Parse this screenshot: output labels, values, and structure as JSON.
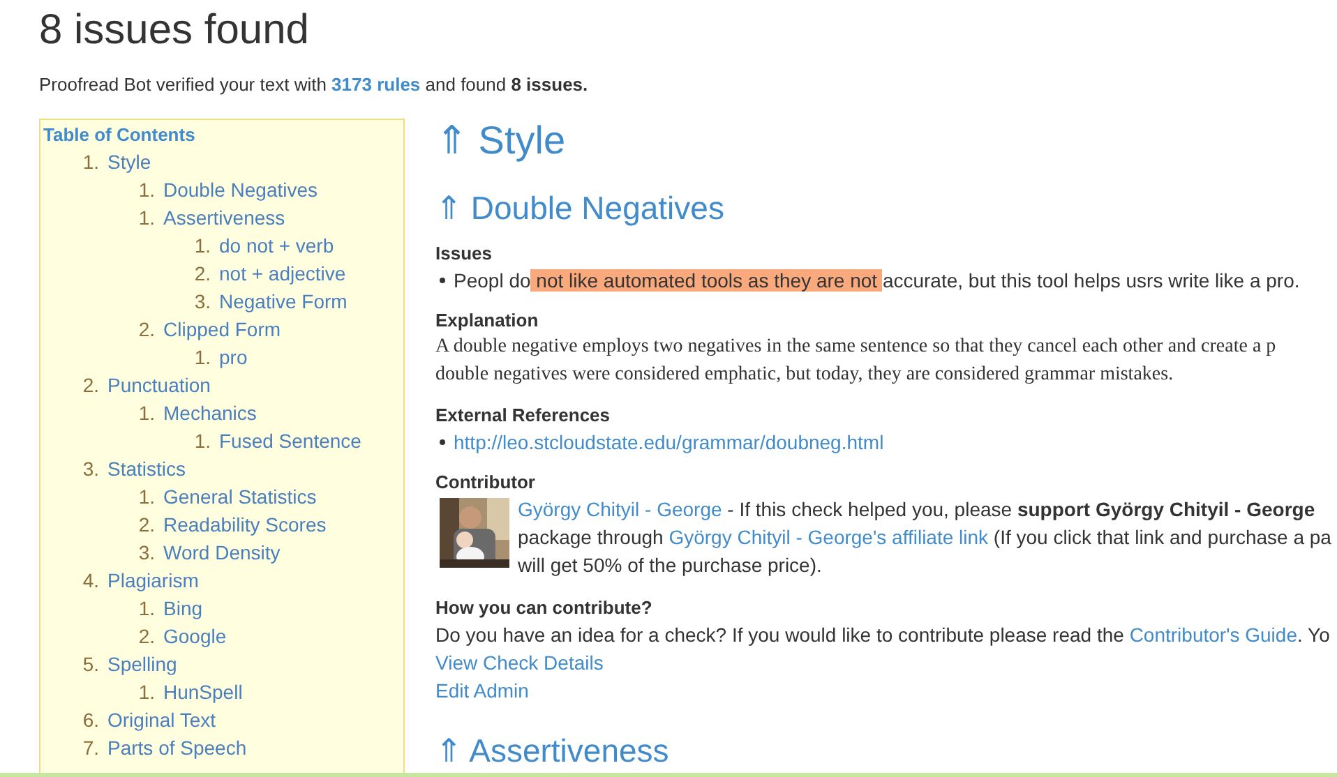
{
  "title": "8 issues found",
  "summary": "Proofread Bot verified your text with ",
  "summary_link": "3173 rules",
  "summary_end": " and found **8 issues.**",
  "toc": {
    "title": "Table of Contents",
    "items": [
      {
        "number": "1.",
        "label": "Style",
        "children": [
          {
            "number": "1.",
            "label": "Double Negatives"
          },
          {
            "number": "1.",
            "label": "Assertiveness",
            "children": [
              {
                "number": "1.",
                "label": "do not + verb"
              },
              {
                "number": "2.",
                "label": "not + adjective"
              },
              {
                "number": "3.",
                "label": "Negative Form"
              }
            ]
          },
          {
            "number": "2.",
            "label": "Clipped Form",
            "children": [
              {
                "number": "1.",
                "label": "pro"
              }
            ]
          }
        ]
      },
      {
        "number": "2.",
        "label": "Punctuation",
        "children": [
          {
            "number": "1.",
            "label": "Mechanics",
            "children": [
              {
                "number": "1.",
                "label": "Fused Sentence"
              }
            ]
          }
        ]
      },
      {
        "number": "3.",
        "label": "Statistics",
        "children": [
          {
            "number": "1.",
            "label": "General Statistics"
          },
          {
            "number": "2.",
            "label": "Readability Scores"
          },
          {
            "number": "3.",
            "label": "Word Density"
          }
        ]
      },
      {
        "number": "4.",
        "label": "Plagiarism",
        "children": [
          {
            "number": "1.",
            "label": "Bing"
          },
          {
            "number": "2.",
            "label": "Google"
          }
        ]
      },
      {
        "number": "5.",
        "label": "Spelling",
        "children": [
          {
            "number": "1.",
            "label": "HunSpell"
          }
        ]
      },
      {
        "number": "6.",
        "label": "Original Text"
      },
      {
        "number": "7.",
        "label": "Parts of Speech"
      }
    ]
  },
  "section_heading": {
    "arrow": "⇑",
    "text": "Style"
  },
  "check_heading": {
    "arrow": "⇑",
    "text": "Double Negatives"
  },
  "issues_label": "Issues",
  "issue": [
    {
      "text": "Peopl do",
      "highlighted": false
    },
    {
      "text": " not like automated tools as they are not ",
      "highlighted": true
    },
    {
      "text": "accurate, but this tool helps usrs write like a pro.",
      "highlighted": false
    }
  ],
  "explanation_label": "Explanation",
  "explanation_lines": [
    "A double negative employs two negatives in the same sentence so that they cancel each other and create a p",
    "double negatives were considered emphatic, but today, they are considered grammar mistakes."
  ],
  "references_label": "External References",
  "references": [
    "http://leo.stcloudstate.edu/grammar/doubneg.html"
  ],
  "contributor_label": "Contributor",
  "contributor_lines": [
    [
      {
        "kind": "link",
        "text": "György Chityil - George"
      },
      {
        "kind": "text",
        "text": " - If this check helped you, please **support György Chityil - George**"
      }
    ],
    [
      {
        "kind": "text",
        "text": "package through "
      },
      {
        "kind": "link",
        "text": "György Chityil - George's affiliate link"
      },
      {
        "kind": "text",
        "text": " (If you click that link and purchase a pa"
      }
    ],
    [
      {
        "kind": "text",
        "text": "will get 50% of the purchase price)."
      }
    ]
  ],
  "contribute_label": "How you can contribute?",
  "contribute_text": "Do you have an idea for a check? If you would like to contribute please read the ",
  "contribute_link": "Contributor's Guide",
  "contribute_end": ". Yo",
  "links": [
    "View Check Details",
    "Edit Admin"
  ],
  "next_heading": {
    "arrow": "⇑",
    "text": "Assertiveness"
  }
}
